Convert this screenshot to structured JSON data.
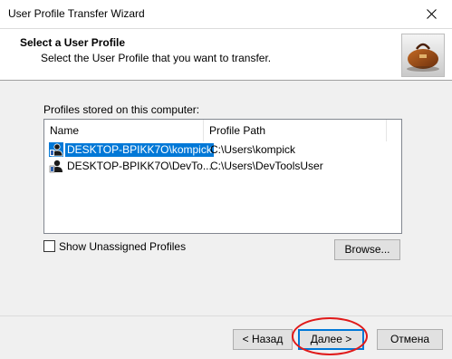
{
  "window": {
    "title": "User Profile Transfer Wizard",
    "close_label": "✕"
  },
  "header": {
    "title": "Select a User Profile",
    "subtitle": "Select the User Profile that you want to transfer."
  },
  "profiles": {
    "group_label": "Profiles stored on this computer:",
    "columns": [
      "Name",
      "Profile Path"
    ],
    "rows": [
      {
        "name": "DESKTOP-BPIKK7O\\kompick",
        "path": "C:\\Users\\kompick",
        "selected": true
      },
      {
        "name": "DESKTOP-BPIKK7O\\DevTo...",
        "path": "C:\\Users\\DevToolsUser",
        "selected": false
      }
    ]
  },
  "options": {
    "show_unassigned_label": "Show Unassigned Profiles",
    "show_unassigned_checked": false
  },
  "buttons": {
    "browse": "Browse...",
    "back": "< Назад",
    "next": "Далее >",
    "cancel": "Отмена"
  },
  "colors": {
    "selection": "#0078d7",
    "annotation": "#e01a1a"
  },
  "icons": {
    "close": "close-icon",
    "header_image": "bag-image",
    "user_profile": "user-profile-icon"
  }
}
